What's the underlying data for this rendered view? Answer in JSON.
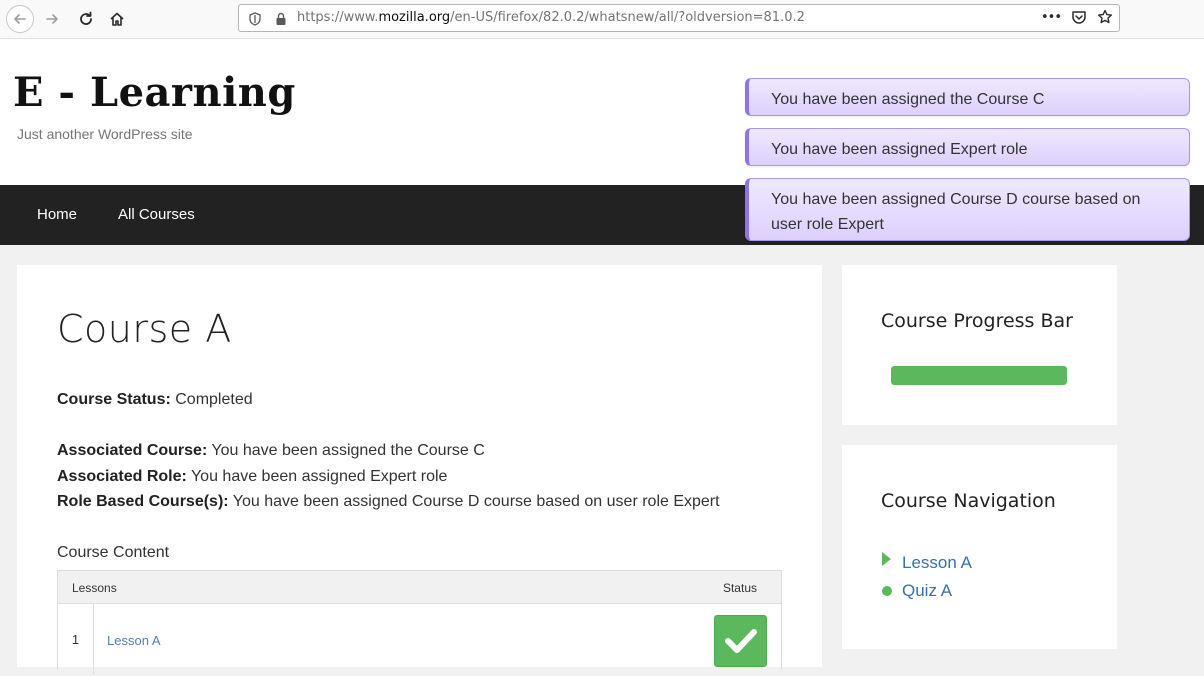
{
  "browser": {
    "url_prefix": "https://www.",
    "url_host": "mozilla.org",
    "url_path": "/en-US/firefox/82.0.2/whatsnew/all/?oldversion=81.0.2",
    "more_label": "•••"
  },
  "site": {
    "title": "E - Learning",
    "tagline": "Just another WordPress site"
  },
  "notices": [
    "You have been assigned the Course C",
    "You have been assigned Expert role",
    "You have been assigned Course D course based on user role Expert"
  ],
  "nav": {
    "items": [
      "Home",
      "All Courses"
    ]
  },
  "course": {
    "title": "Course A",
    "status_label": "Course Status:",
    "status_value": "Completed",
    "associated_course_label": "Associated Course:",
    "associated_course_value": "You have been assigned the Course C",
    "associated_role_label": "Associated Role:",
    "associated_role_value": "You have been assigned Expert role",
    "role_based_label": "Role Based Course(s):",
    "role_based_value": "You have been assigned Course D course based on user role Expert",
    "content_heading": "Course Content",
    "table": {
      "headers": [
        "Lessons",
        "Status"
      ],
      "rows": [
        {
          "num": "1",
          "lesson": "Lesson A",
          "status": "completed"
        }
      ]
    }
  },
  "sidebar": {
    "progress": {
      "title": "Course Progress Bar",
      "percent": 100,
      "color": "#5cb85c"
    },
    "course_nav": {
      "title": "Course Navigation",
      "items": [
        "Lesson A",
        "Quiz A"
      ]
    }
  },
  "colors": {
    "notice_bg": "#e6dcfe",
    "notice_border": "#8f72ec",
    "nav_bg": "#222222",
    "success": "#5cb85c",
    "link": "#3a6fa8"
  }
}
